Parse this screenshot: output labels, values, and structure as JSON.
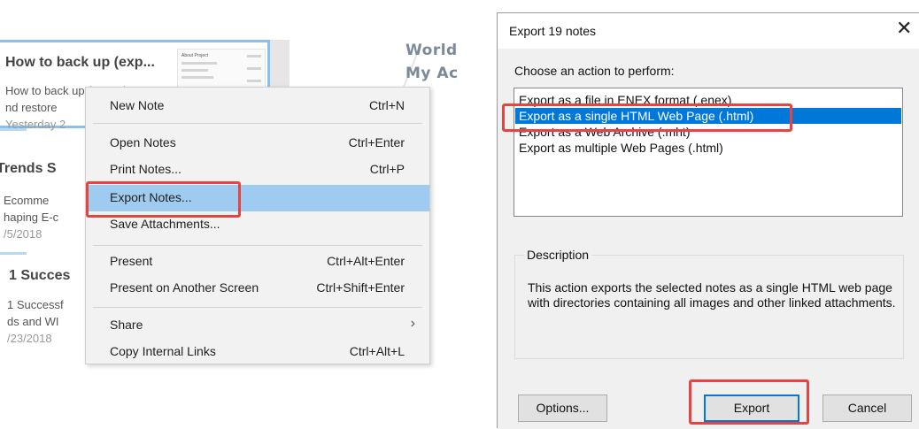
{
  "note_list": {
    "cards": [
      {
        "title": "How to back up (exp...",
        "lines": [
          "How to back up (export)",
          "nd restore"
        ],
        "date": "Yesterday 2",
        "selected": true
      },
      {
        "title": "Trends S",
        "lines": [
          "Ecomme",
          "haping E-c"
        ],
        "date": "/5/2018",
        "selected": false
      },
      {
        "title": "1 Succes",
        "lines": [
          "1 Successf",
          "ds and WI"
        ],
        "date": "/23/2018",
        "selected": false
      }
    ],
    "thumbnail_title": "About Project"
  },
  "background_note": {
    "line1": "World",
    "line2": "My Ac"
  },
  "context_menu": {
    "items": [
      {
        "label": "New Note",
        "shortcut": "Ctrl+N"
      },
      {
        "label": "Open Notes",
        "shortcut": "Ctrl+Enter"
      },
      {
        "label": "Print Notes...",
        "shortcut": "Ctrl+P"
      },
      {
        "label": "Export Notes...",
        "shortcut": "",
        "highlighted": true
      },
      {
        "label": "Save Attachments...",
        "shortcut": ""
      },
      {
        "label": "Present",
        "shortcut": "Ctrl+Alt+Enter"
      },
      {
        "label": "Present on Another Screen",
        "shortcut": "Ctrl+Shift+Enter"
      },
      {
        "label": "Share",
        "shortcut": "",
        "submenu_arrow": "›"
      },
      {
        "label": "Copy Internal Links",
        "shortcut": "Ctrl+Alt+L"
      }
    ]
  },
  "export_dialog": {
    "title": "Export 19 notes",
    "close_glyph": "✕",
    "choose_label": "Choose an action to perform:",
    "options": [
      {
        "label": "Export as a file in ENEX format (.enex)"
      },
      {
        "label": "Export as a single HTML Web Page (.html)",
        "selected": true
      },
      {
        "label": "Export as a Web Archive (.mht)"
      },
      {
        "label": "Export as multiple Web Pages (.html)"
      }
    ],
    "description_legend": "Description",
    "description_text": "This action exports the selected notes as a single HTML web page with directories containing all images and other linked attachments.",
    "buttons": {
      "options": "Options...",
      "export": "Export",
      "cancel": "Cancel"
    }
  },
  "colors": {
    "menu_highlight": "#9fcbf0",
    "list_selection": "#0078d7",
    "annotation_red": "#e8443f"
  }
}
